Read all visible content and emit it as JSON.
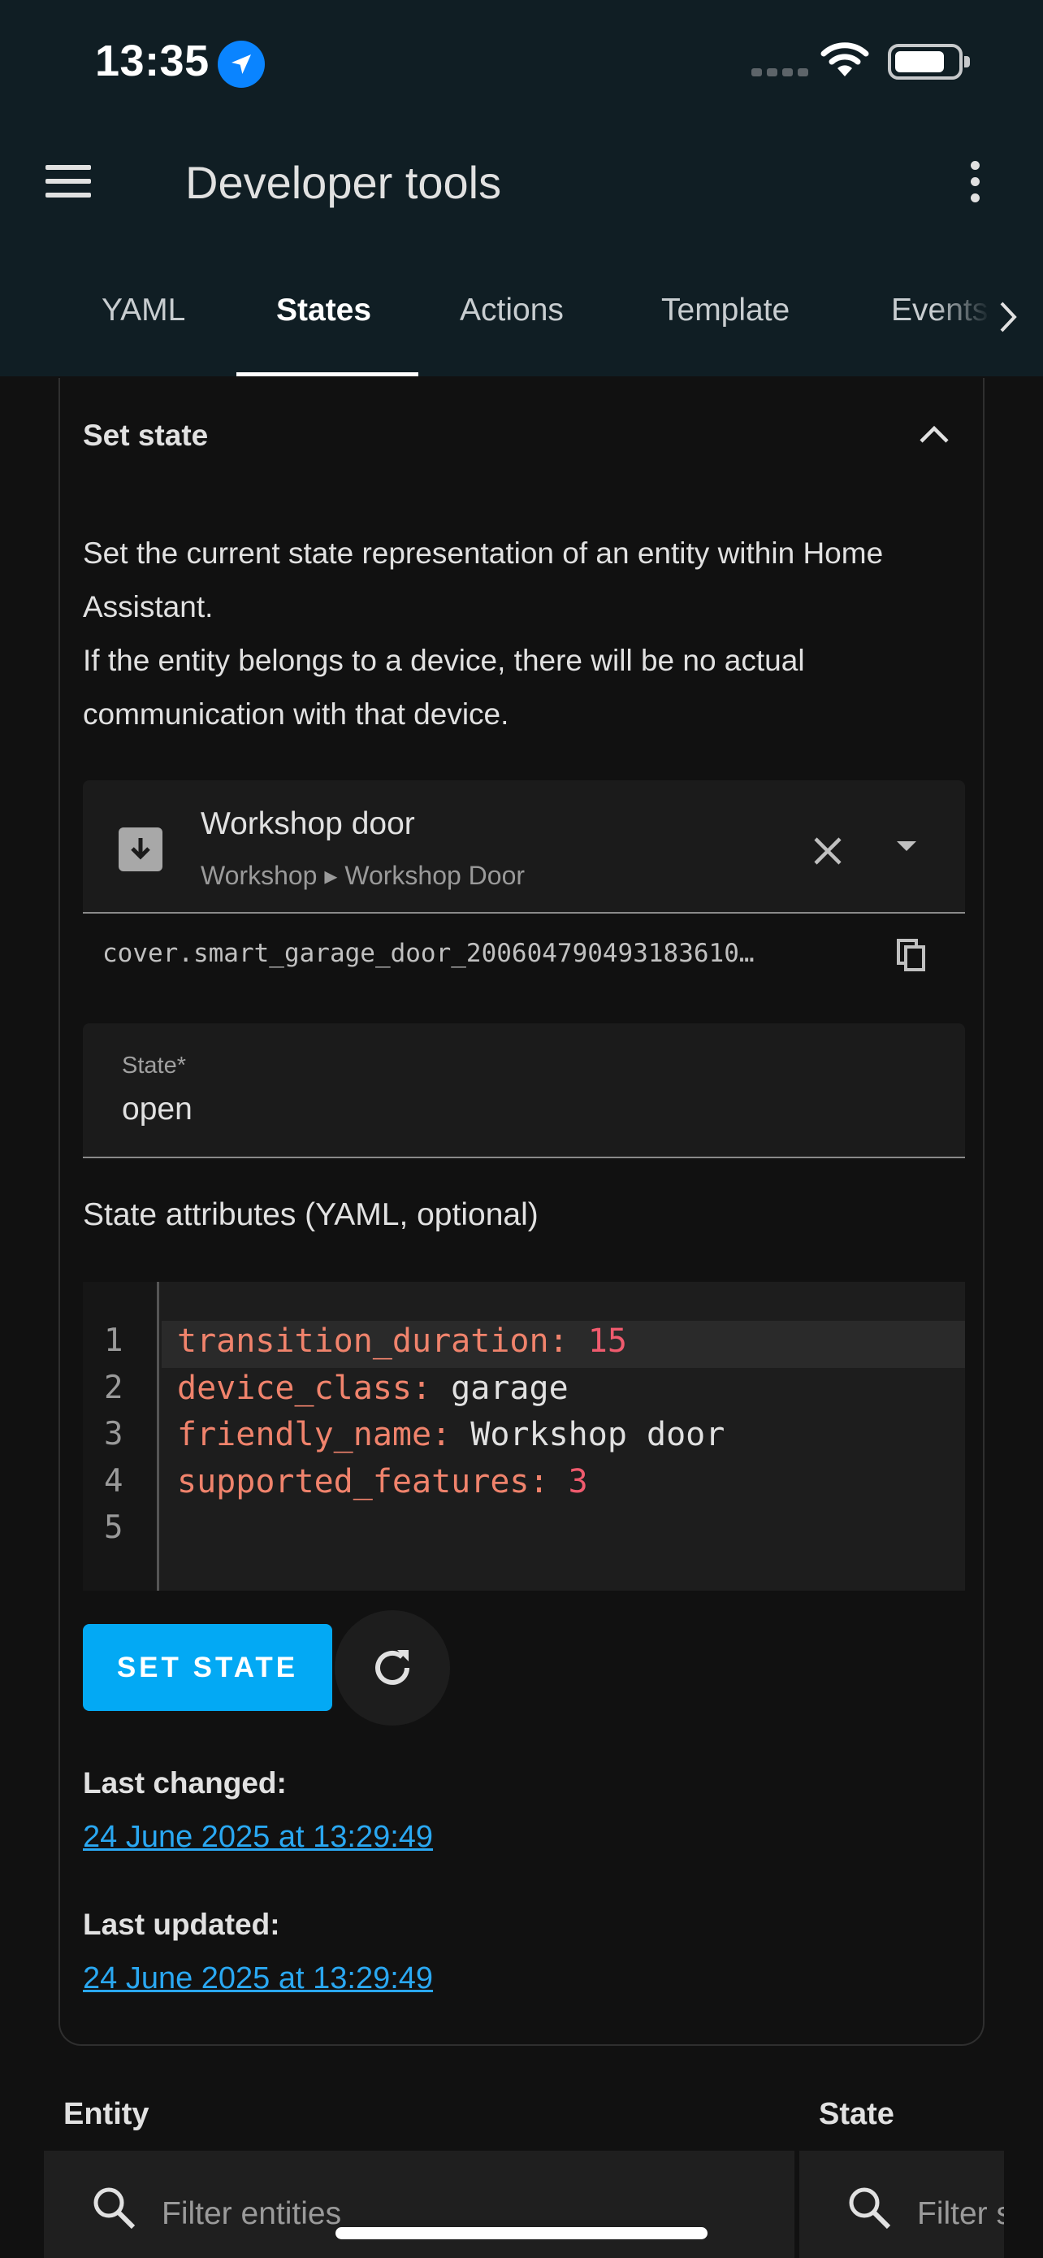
{
  "status_bar": {
    "time": "13:35"
  },
  "header": {
    "title": "Developer tools"
  },
  "tabs": [
    {
      "label": "YAML"
    },
    {
      "label": "States"
    },
    {
      "label": "Actions"
    },
    {
      "label": "Template"
    },
    {
      "label": "Events"
    }
  ],
  "active_tab": "States",
  "card": {
    "title": "Set state",
    "description_line1": "Set the current state representation of an entity within Home Assistant.",
    "description_line2": "If the entity belongs to a device, there will be no actual communication with that device.",
    "entity": {
      "name": "Workshop door",
      "path": "Workshop ▸ Workshop Door",
      "entity_id": "cover.smart_garage_door_200604790493183610…"
    },
    "state_field": {
      "label": "State*",
      "value": "open"
    },
    "attributes_label": "State attributes (YAML, optional)",
    "yaml_lines": [
      {
        "num": "1",
        "key": "transition_duration",
        "colon": ":",
        "value": " 15",
        "type": "number"
      },
      {
        "num": "2",
        "key": "device_class",
        "colon": ":",
        "value": " garage",
        "type": "string"
      },
      {
        "num": "3",
        "key": "friendly_name",
        "colon": ":",
        "value": " Workshop door",
        "type": "string"
      },
      {
        "num": "4",
        "key": "supported_features",
        "colon": ":",
        "value": " 3",
        "type": "number"
      },
      {
        "num": "5",
        "key": "",
        "colon": "",
        "value": "",
        "type": "empty"
      }
    ],
    "set_state_label": "SET STATE",
    "last_changed_label": "Last changed:",
    "last_changed_value": "24 June 2025 at 13:29:49",
    "last_updated_label": "Last updated:",
    "last_updated_value": "24 June 2025 at 13:29:49"
  },
  "table": {
    "entity_header": "Entity",
    "state_header": "State",
    "entity_filter_placeholder": "Filter entities",
    "state_filter_placeholder": "Filter states"
  },
  "colors": {
    "accent": "#03a9f4",
    "link": "#2aa8f2",
    "header_bg": "#101e24"
  }
}
